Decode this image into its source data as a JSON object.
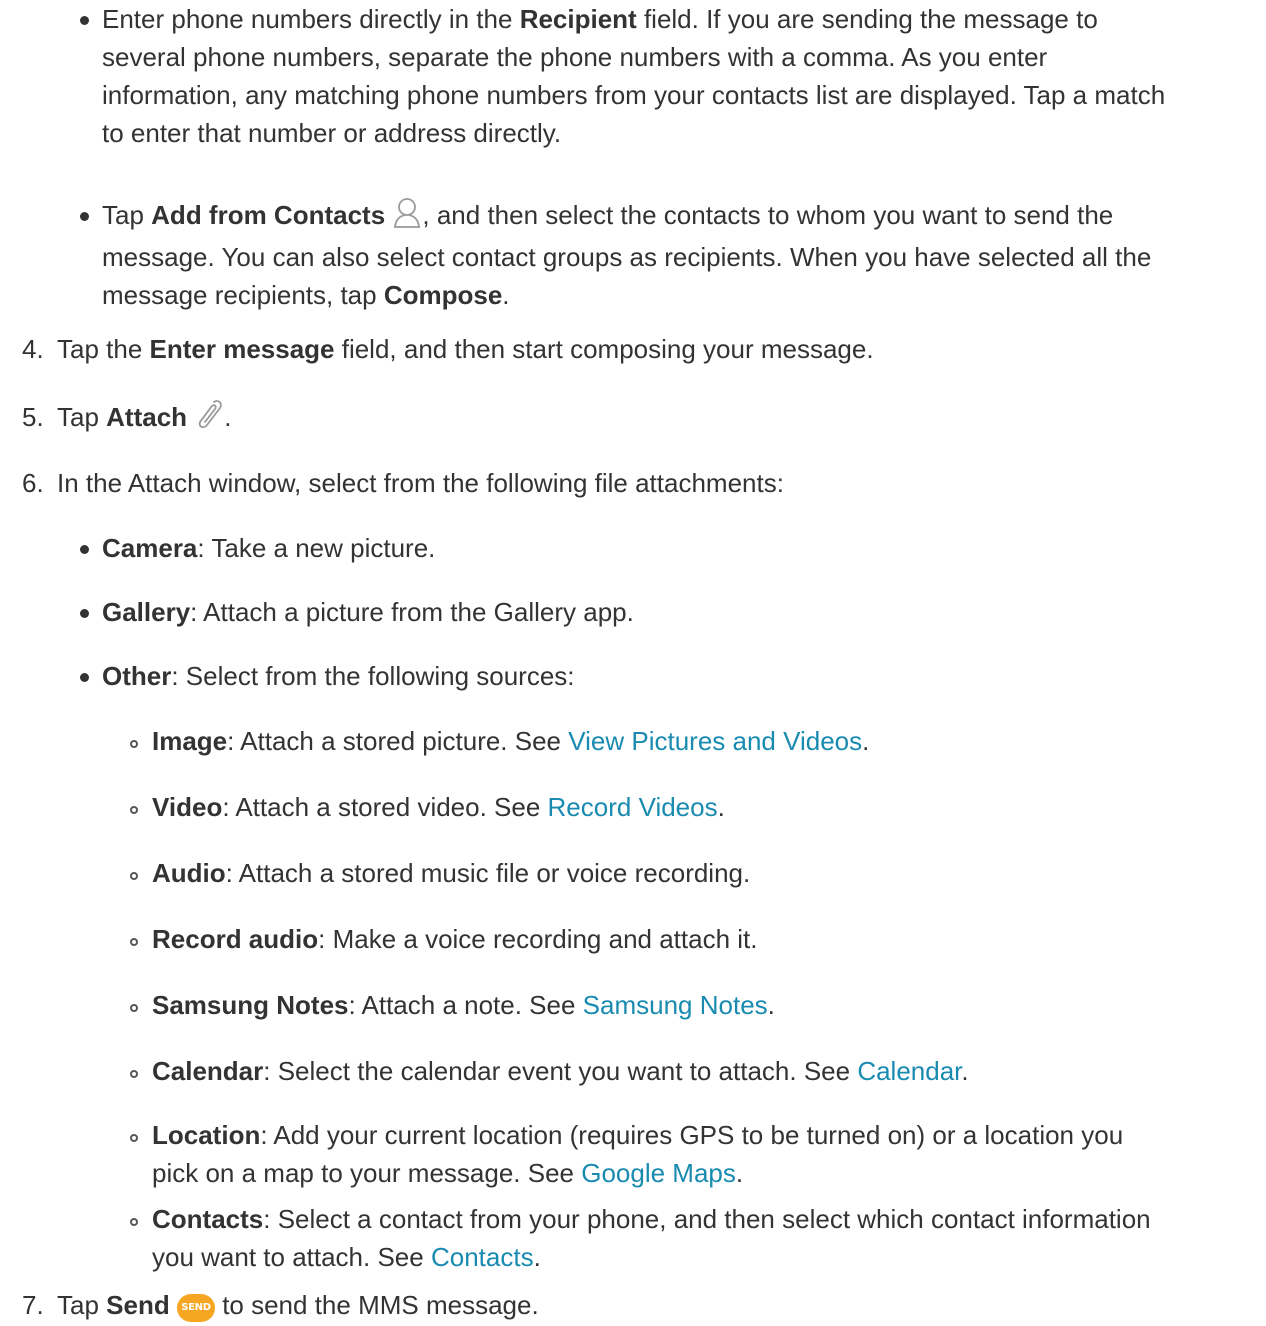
{
  "bullets_top": [
    {
      "lines": [
        [
          "Enter phone numbers directly in the ",
          {
            "b": "Recipient"
          },
          " field. If you are sending the message to"
        ],
        [
          "several phone numbers, separate the phone numbers with a comma. As you enter"
        ],
        [
          "information, any matching phone numbers from your contacts list are displayed. Tap a match"
        ],
        [
          "to enter that number or address directly."
        ]
      ]
    }
  ],
  "contacts_bullet": {
    "l1_pre": "Tap ",
    "l1_bold": "Add from Contacts",
    "l1_post": ", and then select the contacts to whom you want to send the",
    "l2": "message. You can also select contact groups as recipients. When you have selected all the",
    "l3_pre": "message recipients, tap ",
    "l3_bold": "Compose",
    "l3_post": "."
  },
  "step4": {
    "num": "4.",
    "pre": "Tap the ",
    "bold": "Enter message",
    "post": " field, and then start composing your message."
  },
  "step5": {
    "num": "5.",
    "pre": "Tap ",
    "bold": "Attach",
    "post": "."
  },
  "step6": {
    "num": "6.",
    "text": "In the Attach window, select from the following file attachments:"
  },
  "attach_options": [
    {
      "bold": "Camera",
      "text": ": Take a new picture."
    },
    {
      "bold": "Gallery",
      "text": ": Attach a picture from the Gallery app."
    },
    {
      "bold": "Other",
      "text": ": Select from the following sources:"
    }
  ],
  "other_sources": [
    {
      "bold": "Image",
      "text": ": Attach a stored picture. See ",
      "link": "View Pictures and Videos",
      "end": "."
    },
    {
      "bold": "Video",
      "text": ": Attach a stored video. See ",
      "link": "Record Videos",
      "end": "."
    },
    {
      "bold": "Audio",
      "text": ": Attach a stored music file or voice recording.",
      "link": "",
      "end": ""
    },
    {
      "bold": "Record audio",
      "text": ": Make a voice recording and attach it.",
      "link": "",
      "end": ""
    },
    {
      "bold": "Samsung Notes",
      "text": ": Attach a note. See ",
      "link": "Samsung Notes",
      "end": "."
    },
    {
      "bold": "Calendar",
      "text": ": Select the calendar event you want to attach. See ",
      "link": "Calendar",
      "end": "."
    }
  ],
  "location": {
    "bold": "Location",
    "l1": ": Add your current location (requires GPS to be turned on) or a location you",
    "l2_pre": "pick on a map to your message. See ",
    "link": "Google Maps",
    "end": "."
  },
  "contacts": {
    "bold": "Contacts",
    "l1": ": Select a contact from your phone, and then select which contact information",
    "l2_pre": "you want to attach. See ",
    "link": "Contacts",
    "end": "."
  },
  "step7": {
    "num": "7.",
    "pre": "Tap ",
    "bold": "Send",
    "badge": "SEND",
    "post": " to send the MMS message."
  },
  "colors": {
    "text": "#333333",
    "link": "#1a8bb0",
    "send_badge": "#f6a623"
  },
  "icons": {
    "contacts": "person-outline-icon",
    "attach": "paperclip-icon",
    "send": "send-badge-icon"
  }
}
